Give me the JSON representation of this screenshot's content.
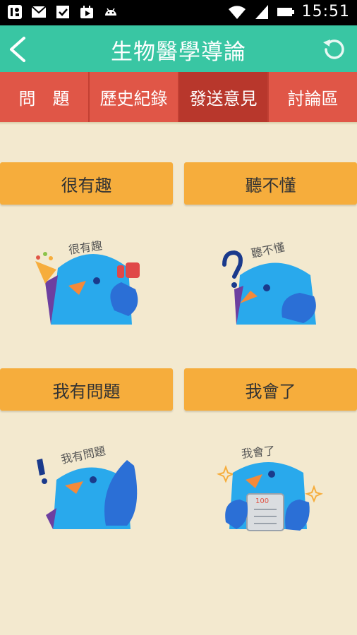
{
  "status_bar": {
    "time": "15:51",
    "left_icons": [
      "dashboard-icon",
      "gmail-icon",
      "checkbox-icon",
      "play-store-icon",
      "android-icon"
    ],
    "right_icons": [
      "wifi-icon",
      "signal-icon",
      "battery-icon"
    ]
  },
  "app_bar": {
    "title": "生物醫學導論",
    "back_icon": "chevron-left-icon",
    "refresh_icon": "refresh-icon"
  },
  "tabs": [
    {
      "label": "問　題",
      "active": false
    },
    {
      "label": "歷史紀錄",
      "active": false
    },
    {
      "label": "發送意見",
      "active": true
    },
    {
      "label": "討論區",
      "active": false
    }
  ],
  "feedback_options": [
    {
      "label": "很有趣",
      "sticker_text": "很有趣"
    },
    {
      "label": "聽不懂",
      "sticker_text": "聽不懂"
    },
    {
      "label": "我有問題",
      "sticker_text": "我有問題"
    },
    {
      "label": "我會了",
      "sticker_text": "我會了"
    }
  ],
  "colors": {
    "status_bar": "#000000",
    "app_bar": "#39C6A3",
    "tab_bar": "#E05647",
    "tab_active": "#B8372C",
    "option_button": "#F6AD3C",
    "background": "#F3E9CF",
    "bird": "#29A9EC"
  }
}
